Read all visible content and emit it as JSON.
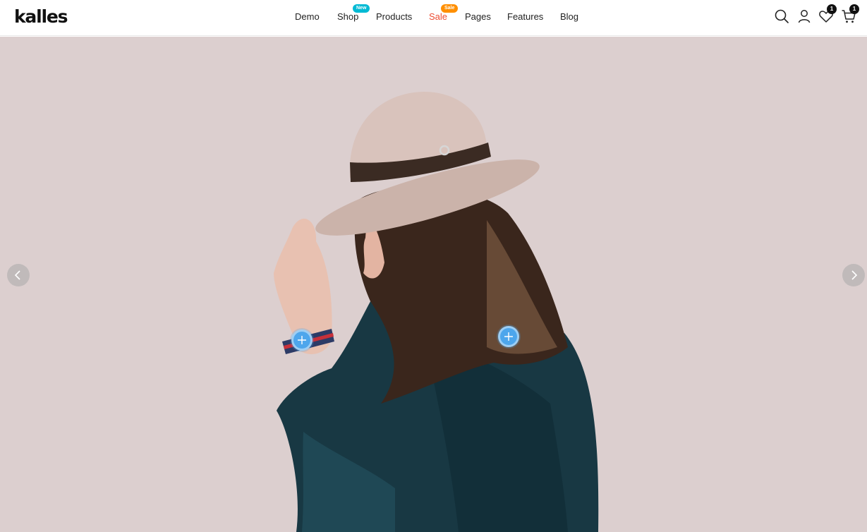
{
  "brand": {
    "logo_text": "kalles"
  },
  "nav": {
    "items": [
      {
        "label": "Demo"
      },
      {
        "label": "Shop",
        "badge": "New"
      },
      {
        "label": "Products"
      },
      {
        "label": "Sale",
        "badge": "Sale"
      },
      {
        "label": "Pages"
      },
      {
        "label": "Features"
      },
      {
        "label": "Blog"
      }
    ]
  },
  "header_icons": {
    "search": "search-icon",
    "account": "user-icon",
    "wishlist": {
      "icon": "heart-icon",
      "count": "1"
    },
    "cart": {
      "icon": "cart-icon",
      "count": "1"
    }
  },
  "hero": {
    "background_color": "#dccfcf",
    "image": "woman-in-hat-photo",
    "prev": "chevron-left-icon",
    "next": "chevron-right-icon",
    "hotspots": [
      "plus-icon",
      "plus-icon"
    ]
  },
  "colors": {
    "badge_new": "#01bad4",
    "badge_sale": "#ff8f00",
    "sale_text": "#ec4c32",
    "hotspot": "#4da6ec"
  }
}
